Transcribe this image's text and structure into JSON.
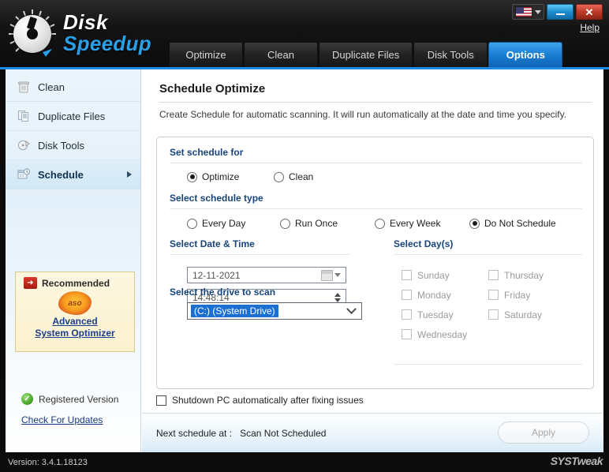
{
  "window": {
    "brand_line1": "Disk",
    "brand_line2": "Speedup",
    "help_label": "Help",
    "minimize_label": "",
    "close_label": "✕",
    "language_icon": "us-flag-icon",
    "accent_color": "#1b7fd4",
    "titlebar_color": "#141414"
  },
  "tabs": [
    {
      "label": "Optimize",
      "active": false
    },
    {
      "label": "Clean",
      "active": false
    },
    {
      "label": "Duplicate Files",
      "active": false
    },
    {
      "label": "Disk Tools",
      "active": false
    },
    {
      "label": "Options",
      "active": true
    }
  ],
  "sidebar": {
    "items": [
      {
        "label": "Clean",
        "icon": "trash-can-icon",
        "active": false
      },
      {
        "label": "Duplicate Files",
        "icon": "documents-icon",
        "active": false
      },
      {
        "label": "Disk Tools",
        "icon": "disk-tools-icon",
        "active": false
      },
      {
        "label": "Schedule",
        "icon": "calendar-clock-icon",
        "active": true
      }
    ],
    "recommended": {
      "badge_glyph": "➜",
      "title": "Recommended",
      "product_logo_text": "aso",
      "link_line1": "Advanced",
      "link_line2": "System Optimizer"
    },
    "registered_label": "Registered Version",
    "registered_icon": "green-check-icon",
    "updates_link": "Check For Updates"
  },
  "main": {
    "page_title": "Schedule Optimize",
    "page_description": "Create Schedule for automatic scanning. It will run automatically at the date and time you specify.",
    "sections": {
      "set_schedule_for": {
        "label": "Set schedule for",
        "options": [
          {
            "label": "Optimize",
            "selected": true
          },
          {
            "label": "Clean",
            "selected": false
          }
        ]
      },
      "select_schedule_type": {
        "label": "Select schedule type",
        "options": [
          {
            "label": "Every Day",
            "selected": false
          },
          {
            "label": "Run Once",
            "selected": false
          },
          {
            "label": "Every Week",
            "selected": false
          },
          {
            "label": "Do Not Schedule",
            "selected": true
          }
        ]
      },
      "select_date_time": {
        "label": "Select Date & Time",
        "date_value": "12-11-2021",
        "time_value": "14:48:14",
        "date_icon": "calendar-icon",
        "time_icon": "spinner-icon"
      },
      "select_days": {
        "label": "Select Day(s)",
        "column_left": [
          {
            "label": "Sunday",
            "checked": false
          },
          {
            "label": "Monday",
            "checked": false
          },
          {
            "label": "Tuesday",
            "checked": false
          },
          {
            "label": "Wednesday",
            "checked": false
          }
        ],
        "column_right": [
          {
            "label": "Thursday",
            "checked": false
          },
          {
            "label": "Friday",
            "checked": false
          },
          {
            "label": "Saturday",
            "checked": false
          }
        ]
      },
      "select_drive": {
        "label": "Select the drive to scan",
        "selected_value": "(C:)  (System Drive)",
        "selection_highlight_color": "#1a6fd0"
      }
    },
    "shutdown_option": {
      "label": "Shutdown PC automatically after fixing issues",
      "checked": false
    },
    "footer": {
      "next_schedule_label": "Next schedule at :",
      "next_schedule_value": "Scan Not Scheduled",
      "apply_label": "Apply"
    }
  },
  "statusbar": {
    "version": "Version: 3.4.1.18123",
    "watermark": "SYSTweak"
  }
}
